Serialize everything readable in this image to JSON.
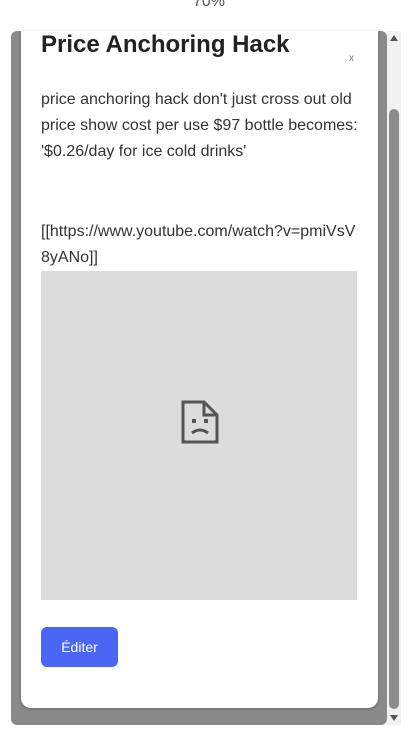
{
  "zoom_label": "70%",
  "card": {
    "close_symbol": "x",
    "title": "Price Anchoring Hack",
    "body": "price anchoring hack don't just cross out old price show cost per use $97 bottle becomes: '$0.26/day for ice cold drinks'",
    "link": "[[https://www.youtube.com/watch?v=pmiVsV8yANo]]",
    "video_placeholder_icon": "broken-document-icon",
    "edit_label": "Éditer"
  },
  "colors": {
    "button": "#4a66f5",
    "frame": "#8a8a8a",
    "video_bg": "#dcdcdc"
  }
}
